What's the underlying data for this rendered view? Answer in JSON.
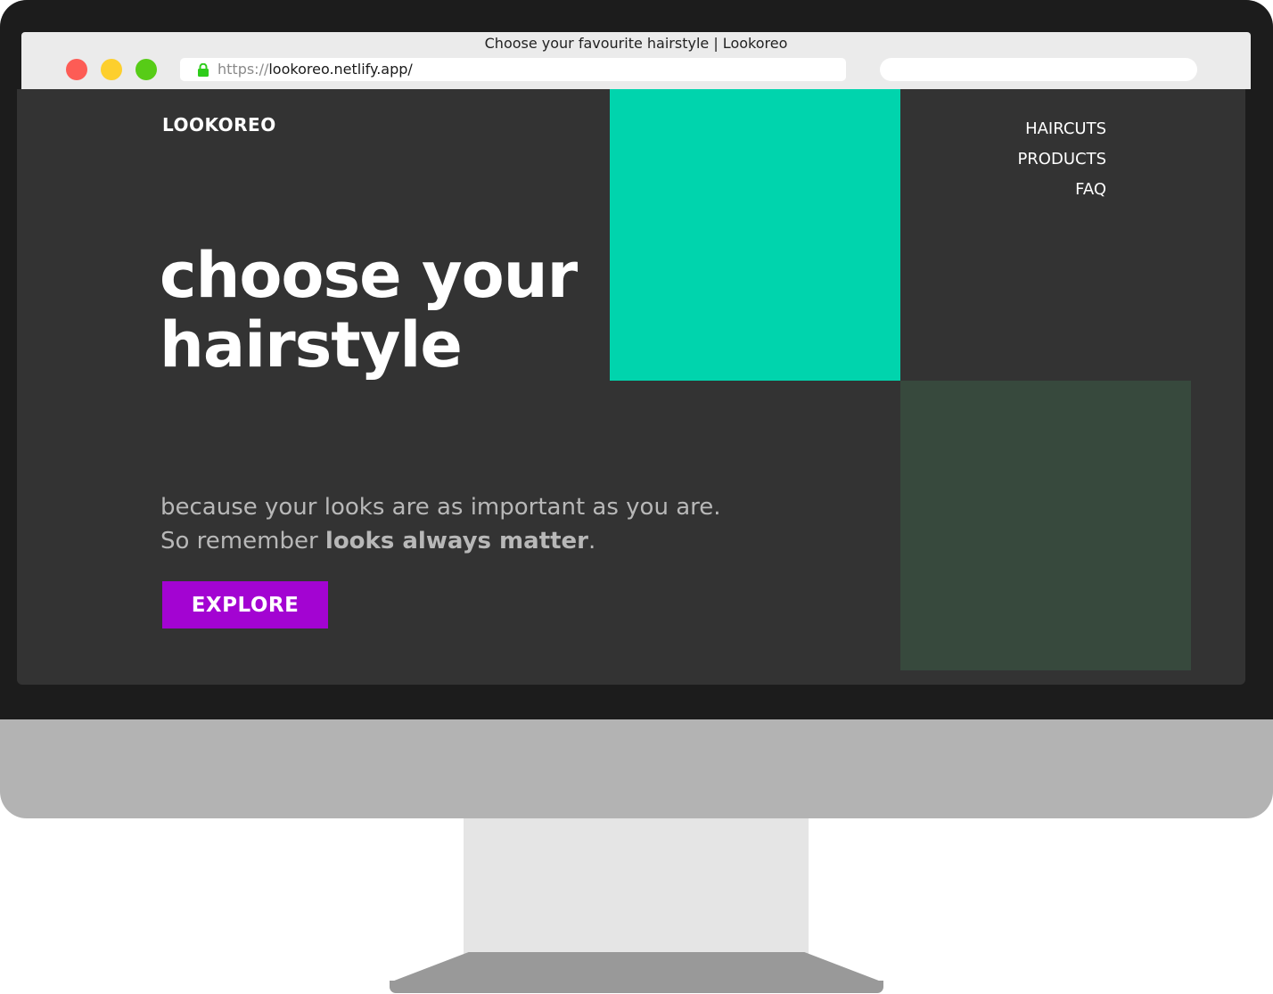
{
  "browser": {
    "window_title": "Choose your favourite hairstyle | Lookoreo",
    "url_protocol": "https://",
    "url_host": "lookoreo.netlify.app/",
    "search_value": ""
  },
  "site": {
    "logo": "LOOKOREO",
    "nav": [
      "HAIRCUTS",
      "PRODUCTS",
      "FAQ"
    ],
    "hero_title_line1": "choose your",
    "hero_title_line2": "hairstyle",
    "tagline_line1": "because your looks are as important as you are.",
    "tagline_line2_prefix": "So remember ",
    "tagline_line2_bold": "looks always matter",
    "tagline_line2_suffix": ".",
    "cta_label": "EXPLORE"
  },
  "colors": {
    "page_background": "#333333",
    "accent_teal": "#00d4ad",
    "accent_dark_green": "#37493d",
    "cta_purple": "#a304d2",
    "traffic_red": "#fd5c55",
    "traffic_yellow": "#fdcf2d",
    "traffic_green": "#57cc17",
    "lock_green": "#2ecc1a"
  },
  "icons": {
    "lock": "lock-icon",
    "close": "close-window-button",
    "minimize": "minimize-window-button",
    "maximize": "maximize-window-button"
  }
}
